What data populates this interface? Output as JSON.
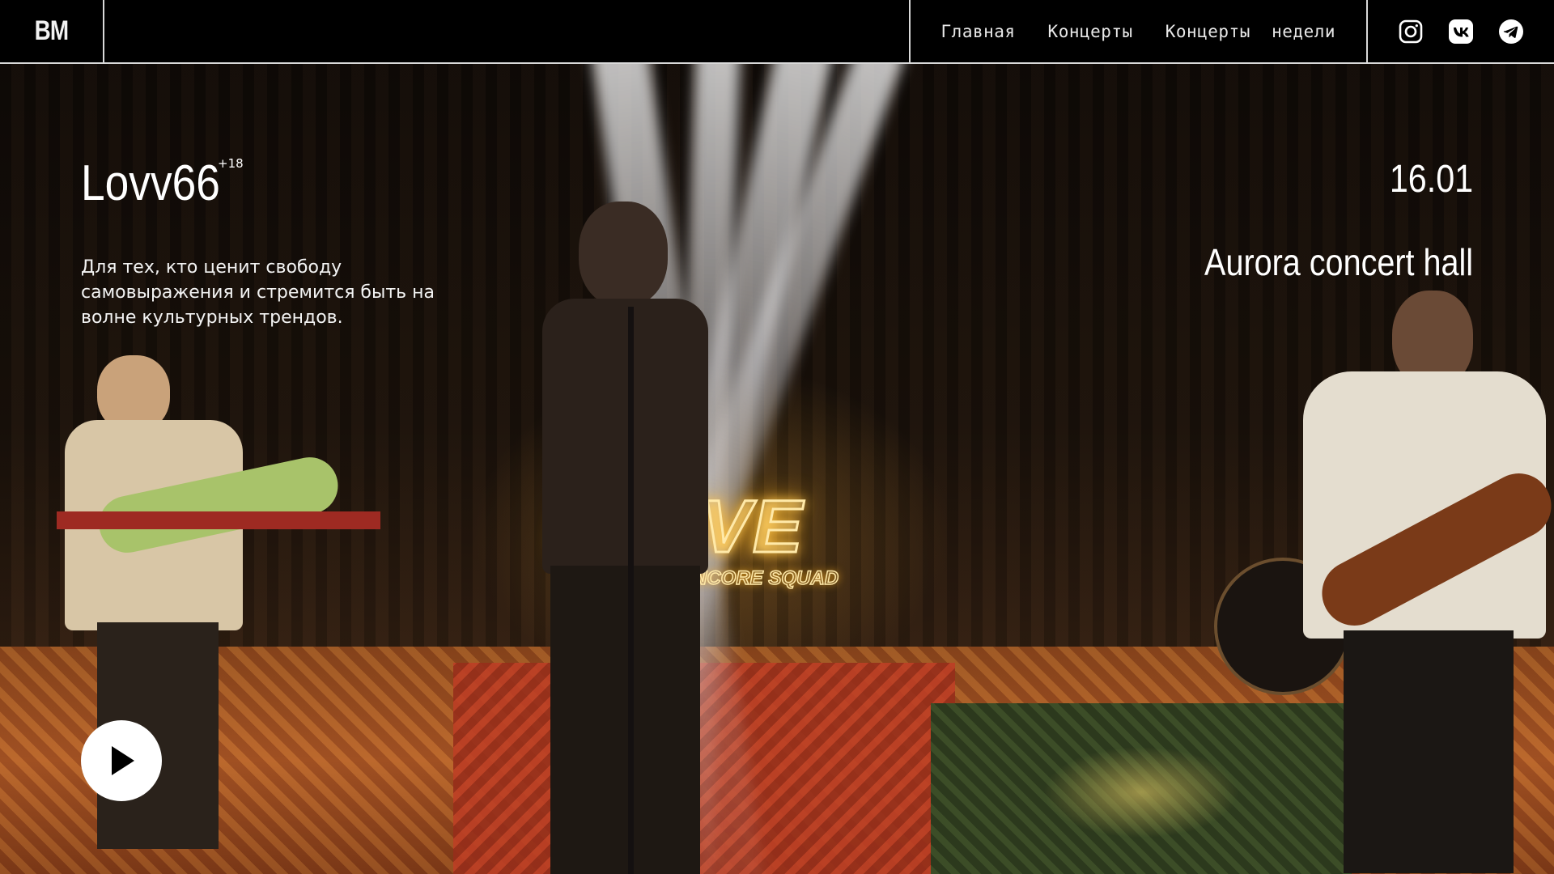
{
  "header": {
    "logo": "BM",
    "nav": [
      "Главная",
      "Концерты",
      "Концерты  недели"
    ],
    "social": [
      "instagram-icon",
      "vk-icon",
      "telegram-icon"
    ]
  },
  "event": {
    "artist": "Lovv66",
    "age_rating": "+18",
    "description": "Для тех, кто ценит свободу самовыражения и стремится быть на волне культурных трендов.",
    "date": "16.01",
    "venue": "Aurora concert hall"
  },
  "background": {
    "neon_main": "E LIVE",
    "neon_sub": "ENCORE SQUAD"
  },
  "colors": {
    "header_bg": "#000000",
    "divider": "#d9d9d9",
    "text": "#ffffff",
    "play_bg": "#ffffff"
  }
}
